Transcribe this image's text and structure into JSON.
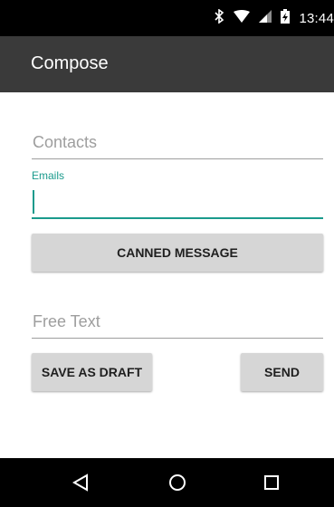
{
  "status_bar": {
    "time": "13:44",
    "icons": [
      "bluetooth-icon",
      "wifi-icon",
      "cell-signal-icon",
      "battery-charging-icon"
    ]
  },
  "action_bar": {
    "title": "Compose"
  },
  "form": {
    "contacts_placeholder": "Contacts",
    "emails_label": "Emails",
    "emails_value": "",
    "canned_message_label": "CANNED MESSAGE",
    "free_text_placeholder": "Free Text",
    "save_as_draft_label": "SAVE AS DRAFT",
    "send_label": "SEND"
  },
  "nav_bar": {
    "icons": [
      "back-icon",
      "home-icon",
      "recents-icon"
    ]
  },
  "colors": {
    "accent": "#1a9a8c",
    "action_bar": "#3a3a3a",
    "button_bg": "#d6d6d6"
  }
}
